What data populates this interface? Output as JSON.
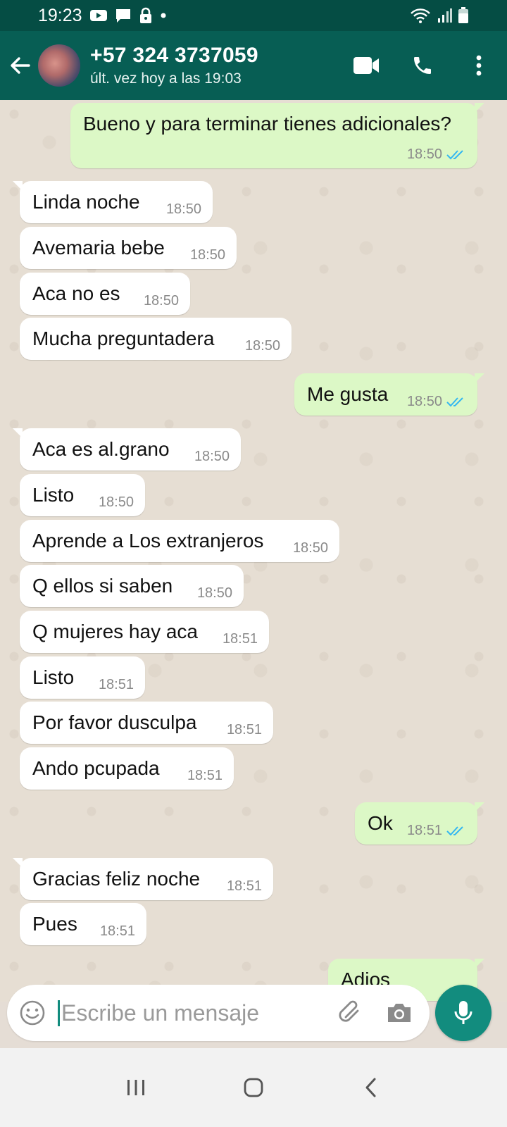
{
  "status_bar": {
    "time": "19:23"
  },
  "header": {
    "contact_name": "+57 324 3737059",
    "last_seen": "últ. vez hoy a las 19:03"
  },
  "messages": [
    {
      "direction": "out",
      "text": "Bueno y para terminar tienes adicionales?",
      "time": "18:50",
      "read": true
    },
    {
      "direction": "in",
      "text": "Linda noche",
      "time": "18:50"
    },
    {
      "direction": "in",
      "text": "Avemaria bebe",
      "time": "18:50"
    },
    {
      "direction": "in",
      "text": "Aca no es",
      "time": "18:50"
    },
    {
      "direction": "in",
      "text": "Mucha preguntadera",
      "time": "18:50"
    },
    {
      "direction": "out",
      "text": "Me gusta",
      "time": "18:50",
      "read": true
    },
    {
      "direction": "in",
      "text": "Aca es al.grano",
      "time": "18:50"
    },
    {
      "direction": "in",
      "text": "Listo",
      "time": "18:50"
    },
    {
      "direction": "in",
      "text": "Aprende a Los extranjeros",
      "time": "18:50"
    },
    {
      "direction": "in",
      "text": "Q ellos si saben",
      "time": "18:50"
    },
    {
      "direction": "in",
      "text": "Q mujeres hay aca",
      "time": "18:51"
    },
    {
      "direction": "in",
      "text": "Listo",
      "time": "18:51"
    },
    {
      "direction": "in",
      "text": "Por favor dusculpa",
      "time": "18:51"
    },
    {
      "direction": "in",
      "text": "Ando pcupada",
      "time": "18:51"
    },
    {
      "direction": "out",
      "text": "Ok",
      "time": "18:51",
      "read": true
    },
    {
      "direction": "in",
      "text": "Gracias feliz noche",
      "time": "18:51"
    },
    {
      "direction": "in",
      "text": "Pues",
      "time": "18:51"
    },
    {
      "direction": "out",
      "text": "Adios",
      "time": "",
      "read": true
    }
  ],
  "composer": {
    "placeholder": "Escribe un mensaje"
  },
  "colors": {
    "header": "#075e54",
    "status_bar": "#054d44",
    "outgoing": "#dcf8c6",
    "incoming": "#ffffff",
    "read_ticks": "#34b7f1",
    "accent": "#128c7e"
  },
  "icons": [
    "back-arrow-icon",
    "video-call-icon",
    "phone-icon",
    "more-vert-icon",
    "emoji-icon",
    "attach-icon",
    "camera-icon",
    "mic-icon"
  ]
}
